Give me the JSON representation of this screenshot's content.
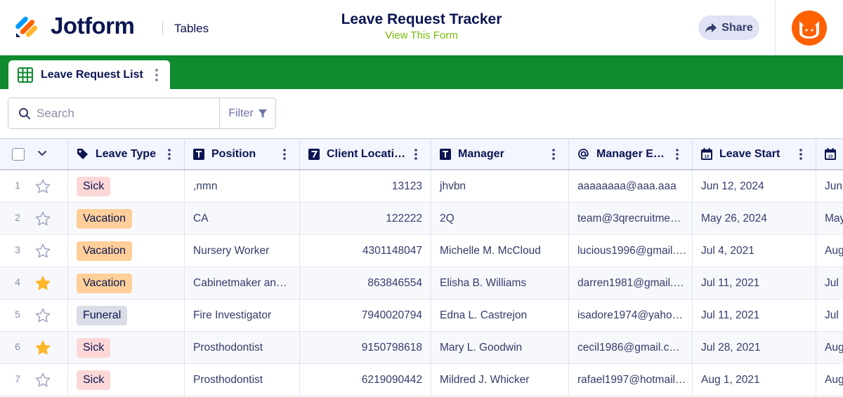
{
  "header": {
    "brand": "Jotform",
    "tables_link": "Tables",
    "title": "Leave Request Tracker",
    "subtitle": "View This Form",
    "share_label": "Share"
  },
  "tab": {
    "label": "Leave Request List"
  },
  "search": {
    "placeholder": "Search",
    "value": ""
  },
  "filter": {
    "label": "Filter"
  },
  "columns": [
    {
      "label": "Leave Type",
      "icon": "tag-icon"
    },
    {
      "label": "Position",
      "icon": "text-field-icon"
    },
    {
      "label": "Client Locati…",
      "icon": "number-field-icon"
    },
    {
      "label": "Manager",
      "icon": "text-field-icon"
    },
    {
      "label": "Manager E…",
      "icon": "at-sign-icon"
    },
    {
      "label": "Leave Start",
      "icon": "calendar-icon"
    }
  ],
  "rows": [
    {
      "num": "1",
      "starred": false,
      "type": "Sick",
      "position": ",nmn",
      "location": "13123",
      "manager": "jhvbn",
      "email": "aaaaaaaa@aaa.aaa",
      "start": "Jun 12, 2024",
      "next": "Jun"
    },
    {
      "num": "2",
      "starred": false,
      "type": "Vacation",
      "position": "CA",
      "location": "122222",
      "manager": "2Q",
      "email": "team@3qrecruitme…",
      "start": "May 26, 2024",
      "next": "May"
    },
    {
      "num": "3",
      "starred": false,
      "type": "Vacation",
      "position": "Nursery Worker",
      "location": "4301148047",
      "manager": "Michelle M. McCloud",
      "email": "lucious1996@gmail.…",
      "start": "Jul 4, 2021",
      "next": "Aug"
    },
    {
      "num": "4",
      "starred": true,
      "type": "Vacation",
      "position": "Cabinetmaker an…",
      "location": "863846554",
      "manager": "Elisha B. Williams",
      "email": "darren1981@gmail.…",
      "start": "Jul 11, 2021",
      "next": "Jul"
    },
    {
      "num": "5",
      "starred": false,
      "type": "Funeral",
      "position": "Fire Investigator",
      "location": "7940020794",
      "manager": "Edna L. Castrejon",
      "email": "isadore1974@yaho…",
      "start": "Jul 11, 2021",
      "next": "Jul"
    },
    {
      "num": "6",
      "starred": true,
      "type": "Sick",
      "position": "Prosthodontist",
      "location": "9150798618",
      "manager": "Mary L. Goodwin",
      "email": "cecil1986@gmail.c…",
      "start": "Jul 28, 2021",
      "next": "Aug"
    },
    {
      "num": "7",
      "starred": false,
      "type": "Sick",
      "position": "Prosthodontist",
      "location": "6219090442",
      "manager": "Mildred J. Whicker",
      "email": "rafael1997@hotmail…",
      "start": "Aug 1, 2021",
      "next": "Aug"
    }
  ],
  "badge_colors": {
    "Sick": "#fdd7d7",
    "Vacation": "#ffcf99",
    "Funeral": "#dadce6"
  },
  "colors": {
    "brand_green": "#0f8a2e",
    "accent_orange": "#ff6100",
    "star_filled": "#ffb629",
    "subtitle_green": "#78bb07"
  }
}
